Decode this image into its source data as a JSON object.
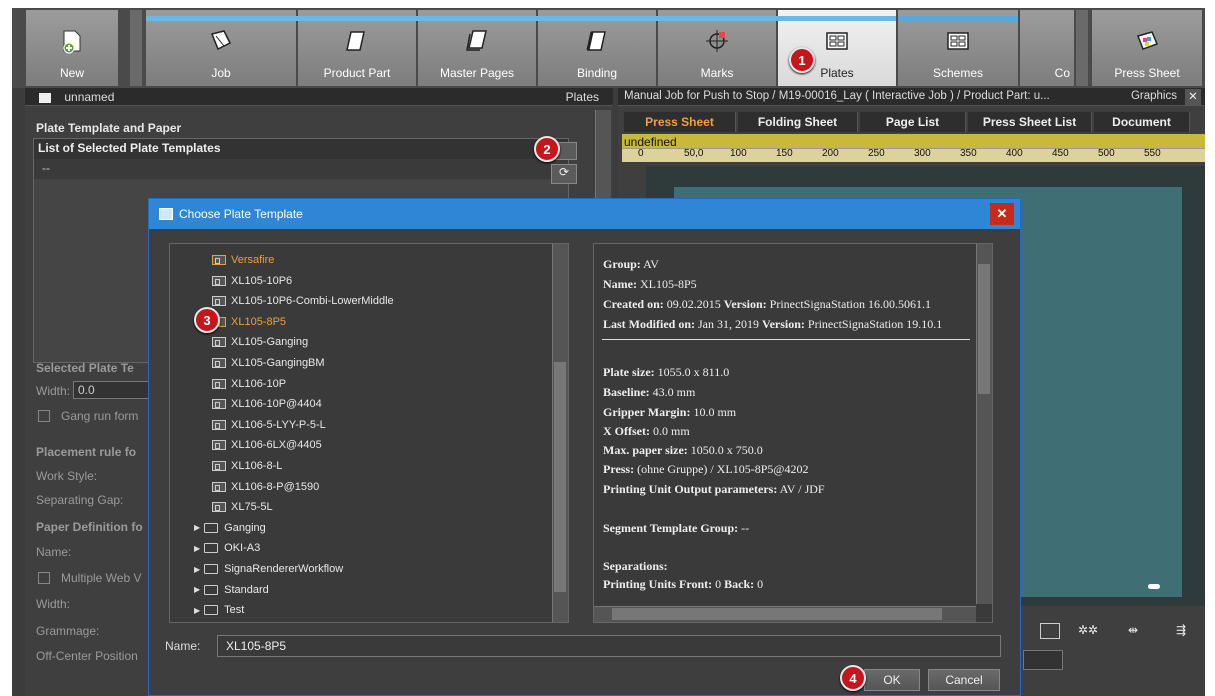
{
  "toolbar": {
    "tabs": [
      {
        "label": "New",
        "icon": "new-doc-icon"
      },
      {
        "label": "Job",
        "icon": "job-icon"
      },
      {
        "label": "Product Part",
        "icon": "product-part-icon"
      },
      {
        "label": "Master Pages",
        "icon": "master-pages-icon"
      },
      {
        "label": "Binding",
        "icon": "binding-icon"
      },
      {
        "label": "Marks",
        "icon": "marks-icon"
      },
      {
        "label": "Plates",
        "icon": "plates-icon"
      },
      {
        "label": "Schemes",
        "icon": "schemes-icon"
      },
      {
        "label": "Co",
        "icon": ""
      },
      {
        "label": "Press Sheet",
        "icon": "press-sheet-icon"
      }
    ]
  },
  "left": {
    "header_name": "unnamed",
    "header_right": "Plates",
    "section1": "Plate Template and Paper",
    "list_title": "List of Selected Plate Templates",
    "list_row": "--",
    "selected_label": "Selected Plate Te",
    "width_label": "Width:",
    "width_value": "0.0",
    "gang_label": "Gang run form",
    "placement_label": "Placement rule fo",
    "work_style": "Work Style:",
    "sep_gap": "Separating Gap:",
    "paper_def": "Paper Definition fo",
    "name_label": "Name:",
    "multi_web": "Multiple Web V",
    "width2": "Width:",
    "grammage": "Grammage:",
    "offcenter": "Off-Center Position"
  },
  "right": {
    "header": "Manual Job for Push to Stop / M19-00016_Lay ( Interactive Job ) / Product Part: u...",
    "header_right": "Graphics",
    "tabs": [
      "Press Sheet",
      "Folding Sheet",
      "Page List",
      "Press Sheet List",
      "Document"
    ],
    "yellow_text": "undefined",
    "ruler": [
      "0",
      "50,0",
      "100",
      "150",
      "200",
      "250",
      "300",
      "350",
      "400",
      "450",
      "500",
      "550"
    ]
  },
  "dialog": {
    "title": "Choose Plate Template",
    "tree": [
      {
        "label": "Versafire",
        "type": "plate",
        "sel": true
      },
      {
        "label": "XL105-10P6",
        "type": "plate"
      },
      {
        "label": "XL105-10P6-Combi-LowerMiddle",
        "type": "plate"
      },
      {
        "label": "XL105-8P5",
        "type": "plate",
        "sel": true
      },
      {
        "label": "XL105-Ganging",
        "type": "plate"
      },
      {
        "label": "XL105-GangingBM",
        "type": "plate"
      },
      {
        "label": "XL106-10P",
        "type": "plate"
      },
      {
        "label": "XL106-10P@4404",
        "type": "plate"
      },
      {
        "label": "XL106-5-LYY-P-5-L",
        "type": "plate"
      },
      {
        "label": "XL106-6LX@4405",
        "type": "plate"
      },
      {
        "label": "XL106-8-L",
        "type": "plate"
      },
      {
        "label": "XL106-8-P@1590",
        "type": "plate"
      },
      {
        "label": "XL75-5L",
        "type": "plate"
      },
      {
        "label": "Ganging",
        "type": "folder"
      },
      {
        "label": "OKI-A3",
        "type": "folder"
      },
      {
        "label": "SignaRendererWorkflow",
        "type": "folder"
      },
      {
        "label": "Standard",
        "type": "folder"
      },
      {
        "label": "Test",
        "type": "folder"
      }
    ],
    "info": {
      "group_k": "Group:",
      "group_v": "AV",
      "name_k": "Name:",
      "name_v": "XL105-8P5",
      "created_k": "Created on:",
      "created_v": "09.02.2015",
      "version_k": "Version:",
      "version1_v": "PrinectSignaStation 16.00.5061.1",
      "modified_k": "Last Modified on:",
      "modified_v": "Jan 31, 2019",
      "version2_v": "PrinectSignaStation 19.10.1",
      "plate_k": "Plate size:",
      "plate_v": "1055.0 x 811.0",
      "baseline_k": "Baseline:",
      "baseline_v": "43.0 mm",
      "gripper_k": "Gripper Margin:",
      "gripper_v": "10.0 mm",
      "xoff_k": "X Offset:",
      "xoff_v": "0.0 mm",
      "maxpaper_k": "Max. paper size:",
      "maxpaper_v": "1050.0 x 750.0",
      "press_k": "Press:",
      "press_v": "(ohne Gruppe) / XL105-8P5@4202",
      "pu_k": "Printing Unit Output parameters:",
      "pu_v": "AV / JDF",
      "seg_k": "Segment Template Group:",
      "seg_v": "--",
      "sep_k": "Separations:",
      "puf_k": "Printing Units Front:",
      "puf_v": "0",
      "back_k": "Back:",
      "back_v": "0"
    },
    "name_label": "Name:",
    "name_value": "XL105-8P5",
    "ok": "OK",
    "cancel": "Cancel"
  },
  "callouts": [
    "1",
    "2",
    "3",
    "4"
  ]
}
